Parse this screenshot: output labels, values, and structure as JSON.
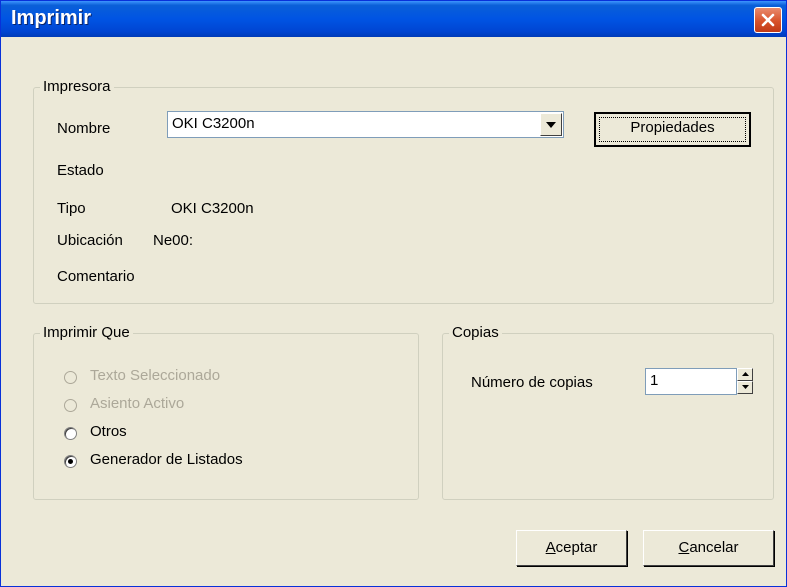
{
  "window": {
    "title": "Imprimir"
  },
  "printer_group": {
    "legend": "Impresora",
    "name_label": "Nombre",
    "selected_printer": "OKI C3200n",
    "properties_button": "Propiedades",
    "status_label": "Estado",
    "status_value": "",
    "type_label": "Tipo",
    "type_value": "OKI C3200n",
    "location_label": "Ubicación",
    "location_value": "Ne00:",
    "comment_label": "Comentario",
    "comment_value": ""
  },
  "print_what_group": {
    "legend": "Imprimir Que",
    "options": [
      {
        "label": "Texto Seleccionado",
        "enabled": false,
        "selected": false
      },
      {
        "label": "Asiento Activo",
        "enabled": false,
        "selected": false
      },
      {
        "label": "Otros",
        "enabled": true,
        "selected": false
      },
      {
        "label": "Generador de Listados",
        "enabled": true,
        "selected": true
      }
    ]
  },
  "copies_group": {
    "legend": "Copias",
    "copies_label": "Número de copias",
    "copies_value": "1"
  },
  "buttons": {
    "accept_mnemonic": "A",
    "accept_rest": "ceptar",
    "cancel_mnemonic": "C",
    "cancel_rest": "ancelar"
  },
  "colors": {
    "titlebar": "#0054e3",
    "dialog_bg": "#ece9d8",
    "close_button": "#d8532b"
  },
  "icons": [
    "close-icon",
    "dropdown-arrow-icon",
    "spin-up-icon",
    "spin-down-icon"
  ]
}
